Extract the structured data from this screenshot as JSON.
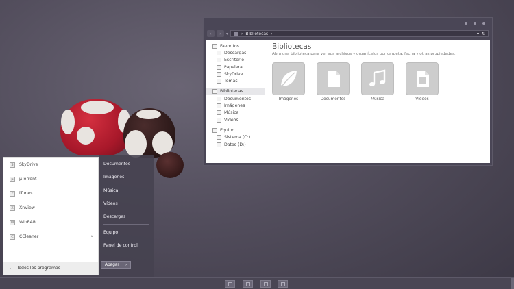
{
  "explorer": {
    "path_label": "Bibliotecas",
    "nav": [
      {
        "label": "Favoritos",
        "icon": "star-icon",
        "children": [
          {
            "label": "Descargas",
            "icon": "downloads-icon"
          },
          {
            "label": "Escritorio",
            "icon": "desktop-icon"
          },
          {
            "label": "Papelera",
            "icon": "trash-icon"
          },
          {
            "label": "SkyDrive",
            "icon": "cloud-icon"
          },
          {
            "label": "Temas",
            "icon": "themes-icon"
          }
        ]
      },
      {
        "label": "Bibliotecas",
        "icon": "library-icon",
        "selected": true,
        "children": [
          {
            "label": "Documentos",
            "icon": "document-icon"
          },
          {
            "label": "Imágenes",
            "icon": "image-icon"
          },
          {
            "label": "Música",
            "icon": "music-icon"
          },
          {
            "label": "Vídeos",
            "icon": "video-icon"
          }
        ]
      },
      {
        "label": "Equipo",
        "icon": "computer-icon",
        "children": [
          {
            "label": "Sistema (C:)",
            "icon": "drive-icon"
          },
          {
            "label": "Datos (D:)",
            "icon": "drive-icon"
          }
        ]
      }
    ],
    "title": "Bibliotecas",
    "description": "Abra una biblioteca para ver sus archivos y organícelos por carpeta, fecha y otras propiedades.",
    "libraries": [
      {
        "label": "Imágenes",
        "icon": "leaf-image-icon"
      },
      {
        "label": "Documentos",
        "icon": "document-icon"
      },
      {
        "label": "Música",
        "icon": "music-note-icon"
      },
      {
        "label": "Vídeos",
        "icon": "film-icon"
      }
    ]
  },
  "start_menu": {
    "programs": [
      {
        "label": "SkyDrive",
        "icon_char": "S"
      },
      {
        "label": "µTorrent",
        "icon_char": "µ"
      },
      {
        "label": "iTunes",
        "icon_char": "♪"
      },
      {
        "label": "XnView",
        "icon_char": "X"
      },
      {
        "label": "WinRAR",
        "icon_char": "W"
      },
      {
        "label": "CCleaner",
        "icon_char": "C",
        "has_submenu": true
      }
    ],
    "all_programs": "Todos los programas",
    "places": [
      "Documentos",
      "Imágenes",
      "Música",
      "Vídeos",
      "Descargas"
    ],
    "places2": [
      "Equipo",
      "Panel de control"
    ],
    "shutdown": "Apagar"
  },
  "colors": {
    "accent": "#4a4656",
    "tile": "#cdcdcd"
  }
}
